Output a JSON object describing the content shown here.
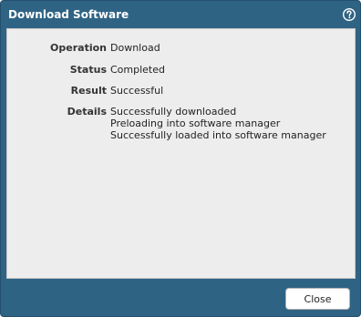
{
  "dialog": {
    "title": "Download Software",
    "help_icon": "help-question-icon"
  },
  "fields": {
    "operation": {
      "label": "Operation",
      "value": "Download"
    },
    "status": {
      "label": "Status",
      "value": "Completed"
    },
    "result": {
      "label": "Result",
      "value": "Successful"
    },
    "details": {
      "label": "Details",
      "lines": [
        "Successfully downloaded",
        "Preloading into software manager",
        "Successfully loaded into software manager"
      ]
    }
  },
  "footer": {
    "close_label": "Close"
  },
  "colors": {
    "titlebar_bg": "#2f6384",
    "content_bg": "#ededed"
  }
}
